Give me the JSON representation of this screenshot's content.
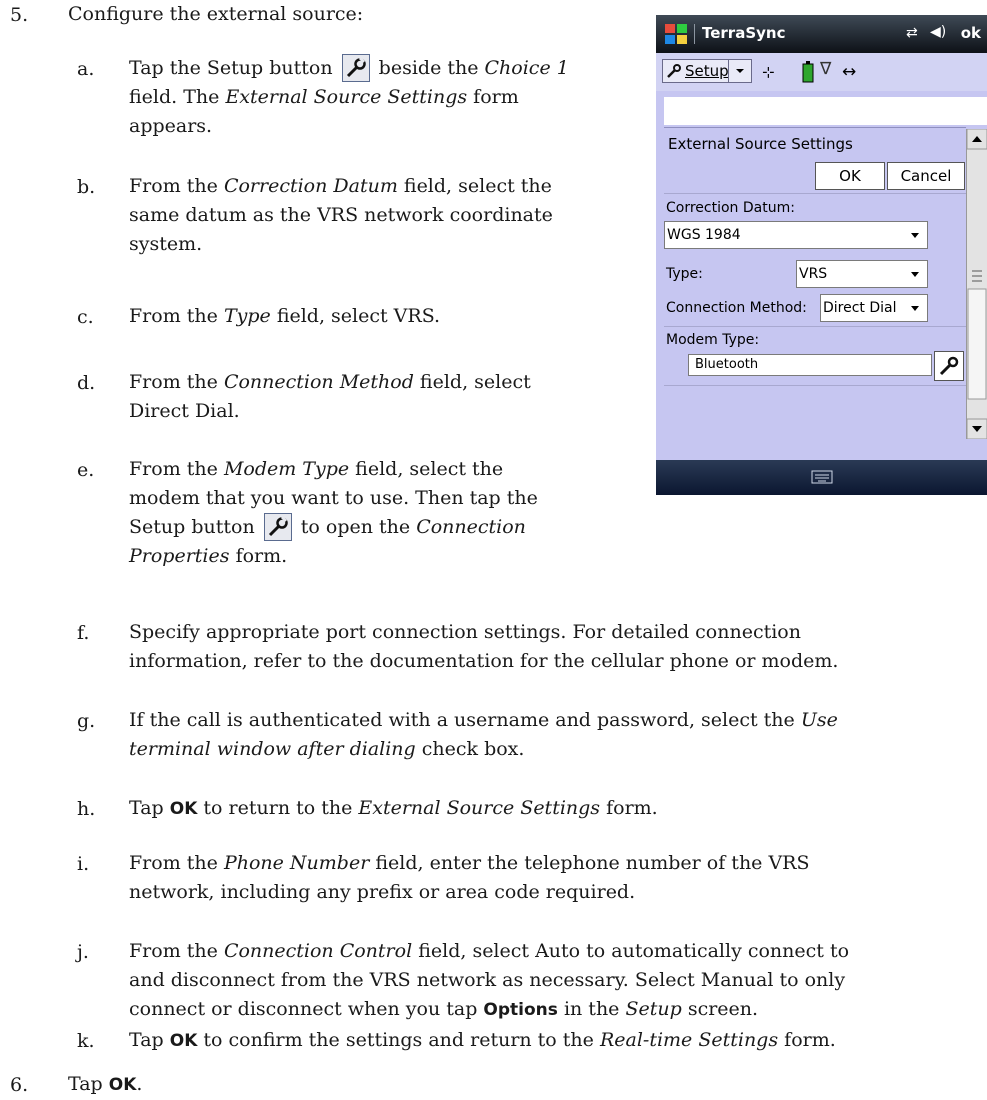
{
  "step5": {
    "number": "5.",
    "text": "Configure the external source:",
    "substeps": {
      "a": {
        "letter": "a.",
        "t1": "Tap the Setup button",
        "t2": "beside the",
        "i1": "Choice 1",
        "t3": "field. The",
        "i2": "External Source Settings",
        "t4": "form",
        "t5": "appears."
      },
      "b": {
        "letter": "b.",
        "t1": "From the",
        "i1": "Correction Datum",
        "t2": "field, select the",
        "t3": "same datum as the VRS network coordinate",
        "t4": "system."
      },
      "c": {
        "letter": "c.",
        "t1": "From the",
        "i1": "Type",
        "t2": "field, select VRS."
      },
      "d": {
        "letter": "d.",
        "t1": "From the",
        "i1": "Connection Method",
        "t2": "field, select",
        "t3": "Direct Dial."
      },
      "e": {
        "letter": "e.",
        "t1": "From the",
        "i1": "Modem Type",
        "t2": "field, select the",
        "t3": "modem that you want to use. Then tap the",
        "t4": "Setup button",
        "t5": "to open the",
        "i2": "Connection",
        "i3": "Properties",
        "t6": "form."
      },
      "f": {
        "letter": "f.",
        "t1": "Specify appropriate port connection settings. For detailed connection",
        "t2": "information, refer to the documentation for the cellular phone or modem."
      },
      "g": {
        "letter": "g.",
        "t1": "If the call is authenticated with a username and password, select the",
        "i1": "Use",
        "i2": "terminal window after dialing",
        "t2": "check box."
      },
      "h": {
        "letter": "h.",
        "t1": "Tap",
        "b1": "OK",
        "t2": "to return to the",
        "i1": "External Source Settings",
        "t3": "form."
      },
      "i": {
        "letter": "i.",
        "t1": "From the",
        "i1": "Phone Number",
        "t2": "field, enter the telephone number of the VRS",
        "t3": "network, including any prefix or area code required."
      },
      "j": {
        "letter": "j.",
        "t1": "From the",
        "i1": "Connection Control",
        "t2": "field, select Auto to automatically connect to",
        "t3": "and disconnect from the VRS network as necessary. Select Manual to only",
        "t4": "connect or disconnect when you tap",
        "b1": "Options",
        "t5": "in the",
        "i2": "Setup",
        "t6": "screen."
      },
      "k": {
        "letter": "k.",
        "t1": "Tap",
        "b1": "OK",
        "t2": "to confirm the settings and return to the",
        "i1": "Real-time Settings",
        "t3": "form."
      }
    }
  },
  "step6": {
    "number": "6.",
    "t1": "Tap",
    "b1": "OK",
    "t2": "."
  },
  "device": {
    "title": "TerraSync",
    "ok": "ok",
    "setup": "Setup",
    "form_title": "External Source Settings",
    "ok_button": "OK",
    "cancel_button": "Cancel",
    "correction_datum_label": "Correction Datum:",
    "correction_datum_value": "WGS 1984",
    "type_label": "Type:",
    "type_value": "VRS",
    "connection_method_label": "Connection Method:",
    "connection_method_value": "Direct Dial",
    "modem_type_label": "Modem Type:",
    "modem_type_value": "Bluetooth"
  }
}
